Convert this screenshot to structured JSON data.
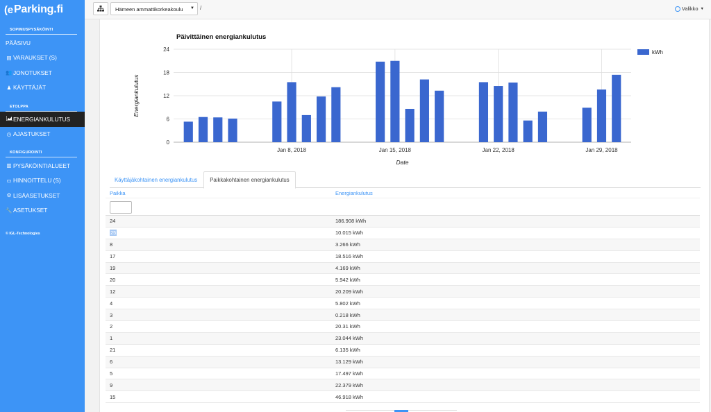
{
  "app": {
    "logo_mark": "(e",
    "logo_text": "Parking.fi"
  },
  "sidebar": {
    "sections": [
      {
        "title": "SOPIMUSPYSÄKÖINTI"
      },
      {
        "title": "ETOLPPA"
      },
      {
        "title": "KONFIGUROINTI"
      }
    ],
    "items": [
      {
        "label": "PÄÄSIVU",
        "icon": ""
      },
      {
        "label": "VARAUKSET (S)",
        "icon": "list-alt-icon"
      },
      {
        "label": "JONOTUKSET",
        "icon": "users-icon"
      },
      {
        "label": "KÄYTTÄJÄT",
        "icon": "user-icon"
      },
      {
        "label": "ENERGIANKULUTUS",
        "icon": "area-chart-icon"
      },
      {
        "label": "AJASTUKSET",
        "icon": "clock-icon"
      },
      {
        "label": "PYSÄKÖINTIALUEET",
        "icon": "map-icon"
      },
      {
        "label": "HINNOITTELU (S)",
        "icon": "money-icon"
      },
      {
        "label": "LISÄASETUKSET",
        "icon": "cogs-icon"
      },
      {
        "label": "ASETUKSET",
        "icon": "wrench-icon"
      }
    ],
    "copyright": "© IGL-Technologies"
  },
  "topbar": {
    "site_select_value": "Hämeen ammattikorkeakoulu",
    "breadcrumb_sep": "/",
    "menu_label": "Valikko"
  },
  "colors": {
    "sidebar": "#3d94f6",
    "bar": "#3a67cf",
    "active_nav": "#222222"
  },
  "chart_data": {
    "type": "bar",
    "title": "Päivittäinen energiankulutus",
    "xlabel": "Date",
    "ylabel": "Energiankulutus",
    "legend": [
      "kWh"
    ],
    "legend_position": "top-right",
    "ylim": [
      0,
      24
    ],
    "yticks": [
      0,
      6,
      12,
      18,
      24
    ],
    "xticks": [
      {
        "date": "2018-01-08",
        "label": "Jan 8, 2018"
      },
      {
        "date": "2018-01-15",
        "label": "Jan 15, 2018"
      },
      {
        "date": "2018-01-22",
        "label": "Jan 22, 2018"
      },
      {
        "date": "2018-01-29",
        "label": "Jan 29, 2018"
      }
    ],
    "grid": true,
    "series": [
      {
        "name": "kWh",
        "points": [
          {
            "date": "2018-01-01",
            "value": 5.3
          },
          {
            "date": "2018-01-02",
            "value": 6.5
          },
          {
            "date": "2018-01-03",
            "value": 6.4
          },
          {
            "date": "2018-01-04",
            "value": 6.1
          },
          {
            "date": "2018-01-07",
            "value": 10.5
          },
          {
            "date": "2018-01-08",
            "value": 15.5
          },
          {
            "date": "2018-01-09",
            "value": 7.0
          },
          {
            "date": "2018-01-10",
            "value": 11.8
          },
          {
            "date": "2018-01-11",
            "value": 14.2
          },
          {
            "date": "2018-01-14",
            "value": 20.8
          },
          {
            "date": "2018-01-15",
            "value": 21.0
          },
          {
            "date": "2018-01-16",
            "value": 8.6
          },
          {
            "date": "2018-01-17",
            "value": 16.2
          },
          {
            "date": "2018-01-18",
            "value": 13.3
          },
          {
            "date": "2018-01-21",
            "value": 15.5
          },
          {
            "date": "2018-01-22",
            "value": 14.5
          },
          {
            "date": "2018-01-23",
            "value": 15.4
          },
          {
            "date": "2018-01-24",
            "value": 5.6
          },
          {
            "date": "2018-01-25",
            "value": 7.9
          },
          {
            "date": "2018-01-28",
            "value": 8.9
          },
          {
            "date": "2018-01-29",
            "value": 13.6
          },
          {
            "date": "2018-01-30",
            "value": 17.4
          }
        ]
      }
    ]
  },
  "tabs": [
    {
      "label": "Käyttäjäkohtainen energiankulutus",
      "active": false
    },
    {
      "label": "Paikkakohtainen energiankulutus",
      "active": true
    }
  ],
  "table": {
    "headers": [
      "Paikka",
      "Energiankulutus"
    ],
    "filter_value": "",
    "rows": [
      {
        "place": "24",
        "energy": "186.908 kWh"
      },
      {
        "place": "25",
        "energy": "10.015 kWh"
      },
      {
        "place": "8",
        "energy": "3.266 kWh"
      },
      {
        "place": "17",
        "energy": "18.516 kWh"
      },
      {
        "place": "19",
        "energy": "4.169 kWh"
      },
      {
        "place": "20",
        "energy": "5.942 kWh"
      },
      {
        "place": "12",
        "energy": "20.209 kWh"
      },
      {
        "place": "4",
        "energy": "5.802 kWh"
      },
      {
        "place": "3",
        "energy": "0.218 kWh"
      },
      {
        "place": "2",
        "energy": "20.31 kWh"
      },
      {
        "place": "1",
        "energy": "23.044 kWh"
      },
      {
        "place": "21",
        "energy": "6.135 kWh"
      },
      {
        "place": "6",
        "energy": "13.129 kWh"
      },
      {
        "place": "5",
        "energy": "17.497 kWh"
      },
      {
        "place": "9",
        "energy": "22.379 kWh"
      },
      {
        "place": "15",
        "energy": "46.918 kWh"
      }
    ]
  }
}
